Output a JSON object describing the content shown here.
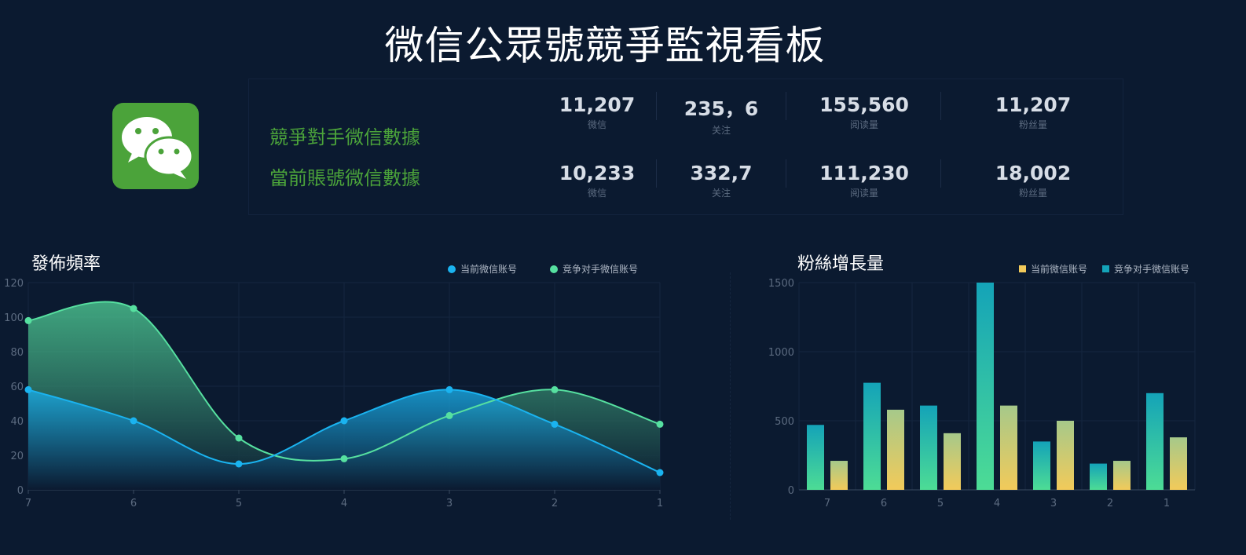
{
  "header": {
    "title": "微信公眾號競爭監視看板"
  },
  "stats": {
    "rows": [
      {
        "label": "競爭對手微信數據",
        "items": [
          {
            "value": "11,207",
            "label": "微信"
          },
          {
            "value": "235，6",
            "label": "关注"
          },
          {
            "value": "155,560",
            "label": "阅读量"
          },
          {
            "value": "11,207",
            "label": "粉丝量"
          }
        ]
      },
      {
        "label": "當前賬號微信數據",
        "items": [
          {
            "value": "10,233",
            "label": "微信"
          },
          {
            "value": "332,7",
            "label": "关注"
          },
          {
            "value": "111,230",
            "label": "阅读量"
          },
          {
            "value": "18,002",
            "label": "粉丝量"
          }
        ]
      }
    ]
  },
  "icons": {
    "logo": "wechat-logo-icon"
  },
  "colors": {
    "background": "#0b1a30",
    "brand_green": "#4ba33a",
    "line_current": "#1ab3f0",
    "line_competitor": "#56e0a0",
    "bar_current": "#f2ca5a",
    "bar_competitor": "#14a3b8"
  },
  "chart_data": [
    {
      "type": "area",
      "title": "發佈頻率",
      "categories": [
        "7",
        "6",
        "5",
        "4",
        "3",
        "2",
        "1"
      ],
      "ylim": [
        0,
        120
      ],
      "yticks": [
        0,
        20,
        40,
        60,
        80,
        100,
        120
      ],
      "grid": true,
      "legend_position": "top-right",
      "series": [
        {
          "name": "当前微信账号",
          "values": [
            58,
            40,
            15,
            40,
            58,
            38,
            10
          ]
        },
        {
          "name": "竞争对手微信账号",
          "values": [
            98,
            105,
            30,
            18,
            43,
            58,
            38
          ]
        }
      ]
    },
    {
      "type": "bar",
      "title": "粉絲增長量",
      "categories": [
        "7",
        "6",
        "5",
        "4",
        "3",
        "2",
        "1"
      ],
      "ylim": [
        0,
        1500
      ],
      "yticks": [
        0,
        500,
        1000,
        1500
      ],
      "grid": true,
      "legend_position": "top-right",
      "series": [
        {
          "name": "竞争对手微信账号",
          "values": [
            470,
            775,
            610,
            1500,
            350,
            190,
            700
          ]
        },
        {
          "name": "当前微信账号",
          "values": [
            210,
            580,
            410,
            610,
            500,
            210,
            380
          ]
        }
      ]
    }
  ]
}
